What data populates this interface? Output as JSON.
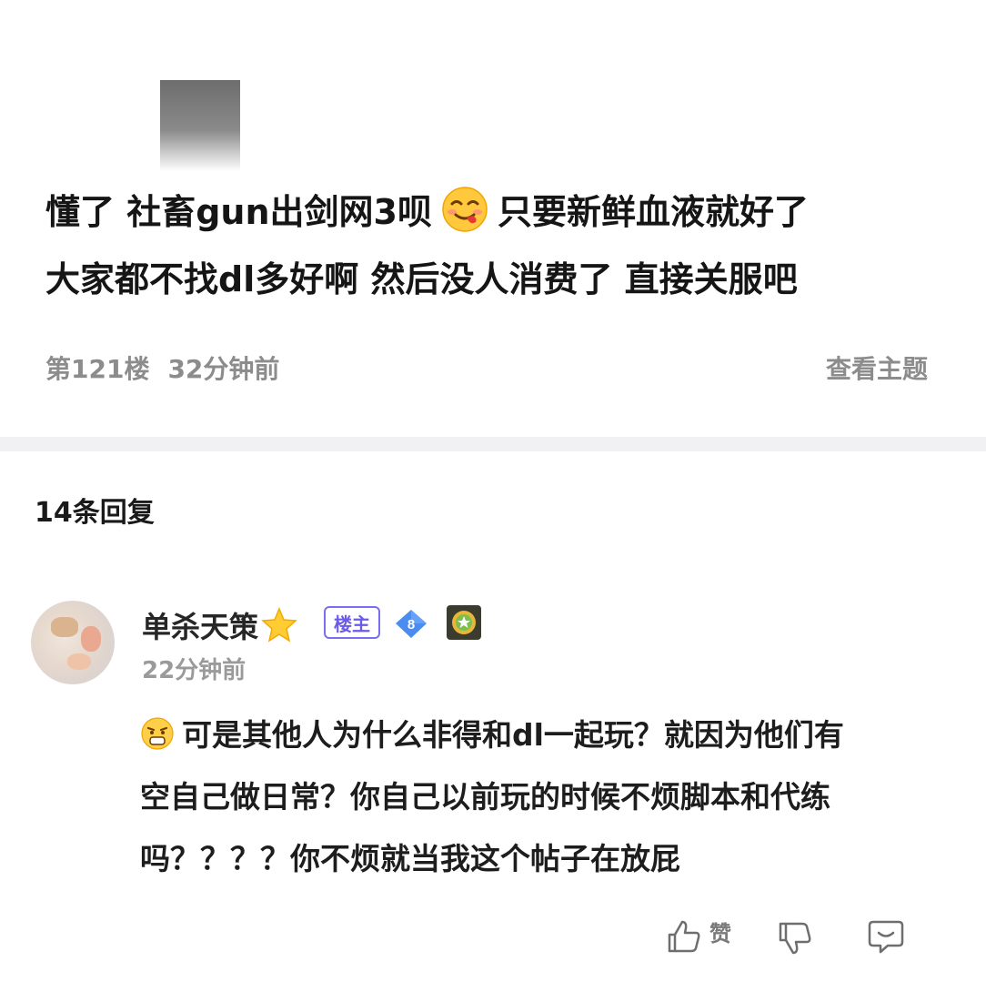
{
  "post": {
    "line1_a": "懂了 社畜gun出剑网3呗",
    "line1_b": "只要新鲜血液就好了",
    "line2": "大家都不找dl多好啊 然后没人消费了 直接关服吧",
    "emoji": "yum-face-icon",
    "floor": "第121楼",
    "time": "32分钟前",
    "view_topic_label": "查看主题"
  },
  "replies": {
    "count_label": "14条回复"
  },
  "reply": {
    "username": "单杀天策",
    "owner_badge": "楼主",
    "level": "8",
    "time": "22分钟前",
    "line1": "可是其他人为什么非得和dl一起玩？就因为他们有",
    "line2": "空自己做日常？你自己以前玩的时候不烦脚本和代练",
    "line3": "吗？？？？你不烦就当我这个帖子在放屁",
    "like_label": "赞"
  },
  "colors": {
    "owner_badge": "#6a5be8",
    "level_badge": "#4a8cf0",
    "meta_text": "#8c8c8c",
    "divider": "#f1f1f3"
  }
}
